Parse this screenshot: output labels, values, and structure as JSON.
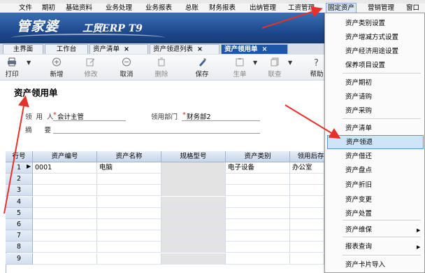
{
  "menubar": {
    "items": [
      "文件",
      "期初",
      "基础资料",
      "业务处理",
      "业务报表",
      "总账",
      "财务报表",
      "出纳管理",
      "工资管理",
      "固定资产",
      "营销管理",
      "窗口"
    ]
  },
  "banner": {
    "logo_main": "管家婆",
    "logo_sub": "工贸ERP T9"
  },
  "tabs": [
    {
      "label": "主界面"
    },
    {
      "label": "工作台"
    },
    {
      "label": "资产清单"
    },
    {
      "label": "资产领退列表"
    },
    {
      "label": "资产领用单"
    }
  ],
  "tab_close": "×",
  "toolbar": {
    "print": "打印",
    "new": "新增",
    "modify": "修改",
    "cancel": "取消",
    "delete": "删除",
    "save": "保存",
    "generate": "生单",
    "query": "联查",
    "help": "帮助"
  },
  "form": {
    "title": "资产领用单",
    "user_label": "领用人",
    "user_value": "会计主管",
    "dept_label": "领用部门",
    "dept_value": "财务部2",
    "summary_label": "摘要",
    "required_mark": "*"
  },
  "grid": {
    "columns": [
      "行号",
      "资产编号",
      "资产名称",
      "规格型号",
      "资产类别",
      "领用后存"
    ],
    "rows": [
      {
        "no": "1",
        "code": "0001",
        "name": "电脑",
        "spec": "",
        "category": "电子设备",
        "location": "办公室"
      },
      {
        "no": "2",
        "code": "",
        "name": "",
        "spec": "",
        "category": "",
        "location": ""
      },
      {
        "no": "3",
        "code": "",
        "name": "",
        "spec": "",
        "category": "",
        "location": ""
      },
      {
        "no": "4",
        "code": "",
        "name": "",
        "spec": "",
        "category": "",
        "location": ""
      },
      {
        "no": "5",
        "code": "",
        "name": "",
        "spec": "",
        "category": "",
        "location": ""
      },
      {
        "no": "6",
        "code": "",
        "name": "",
        "spec": "",
        "category": "",
        "location": ""
      },
      {
        "no": "7",
        "code": "",
        "name": "",
        "spec": "",
        "category": "",
        "location": ""
      },
      {
        "no": "8",
        "code": "",
        "name": "",
        "spec": "",
        "category": "",
        "location": ""
      },
      {
        "no": "9",
        "code": "",
        "name": "",
        "spec": "",
        "category": "",
        "location": ""
      }
    ]
  },
  "dropdown": {
    "items": [
      "资产类别设置",
      "资产增减方式设置",
      "资产经济用途设置",
      "保养项目设置",
      "资产期初",
      "资产请购",
      "资产采购",
      "资产清单",
      "资产领退",
      "资产借还",
      "资产盘点",
      "资产折旧",
      "资产变更",
      "资产处置",
      "资产维保",
      "报表查询",
      "资产卡片导入"
    ],
    "highlighted": "资产领退"
  },
  "colors": {
    "accent": "#1e56a8",
    "highlight": "#cfe3f9",
    "arrow": "#e8302a"
  }
}
